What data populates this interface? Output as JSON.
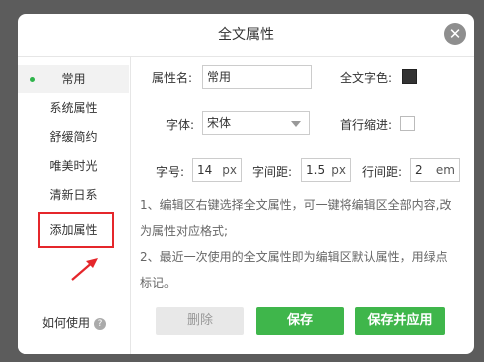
{
  "dialog": {
    "title": "全文属性",
    "close_glyph": "✕"
  },
  "sidebar": {
    "items": [
      {
        "label": "常用",
        "active": true
      },
      {
        "label": "系统属性",
        "active": false
      },
      {
        "label": "舒缓简约",
        "active": false
      },
      {
        "label": "唯美时光",
        "active": false
      },
      {
        "label": "清新日系",
        "active": false
      },
      {
        "label": "添加属性",
        "active": false
      }
    ],
    "help_label": "如何使用",
    "help_glyph": "?"
  },
  "form": {
    "name_label": "属性名:",
    "name_value": "常用",
    "text_color_label": "全文字色:",
    "text_color": "#333333",
    "font_label": "字体:",
    "font_value": "宋体",
    "indent_label": "首行缩进:",
    "indent_checked": false,
    "size_label": "字号:",
    "size_value": "14",
    "size_unit": "px",
    "spacing_label": "字间距:",
    "spacing_value": "1.5",
    "spacing_unit": "px",
    "line_label": "行间距:",
    "line_value": "2",
    "line_unit": "em"
  },
  "notes": {
    "note1": "1、编辑区右键选择全文属性，可一键将编辑区全部内容,改为属性对应格式;",
    "note2": "2、最近一次使用的全文属性即为编辑区默认属性，用绿点标记。"
  },
  "buttons": {
    "delete": "删除",
    "save": "保存",
    "save_apply": "保存并应用"
  },
  "colors": {
    "accent": "#3fb64b",
    "highlight": "#e5262b",
    "backdrop": "#5f5f5f"
  },
  "annotation": {
    "arrow_icon": "red-arrow-icon"
  }
}
